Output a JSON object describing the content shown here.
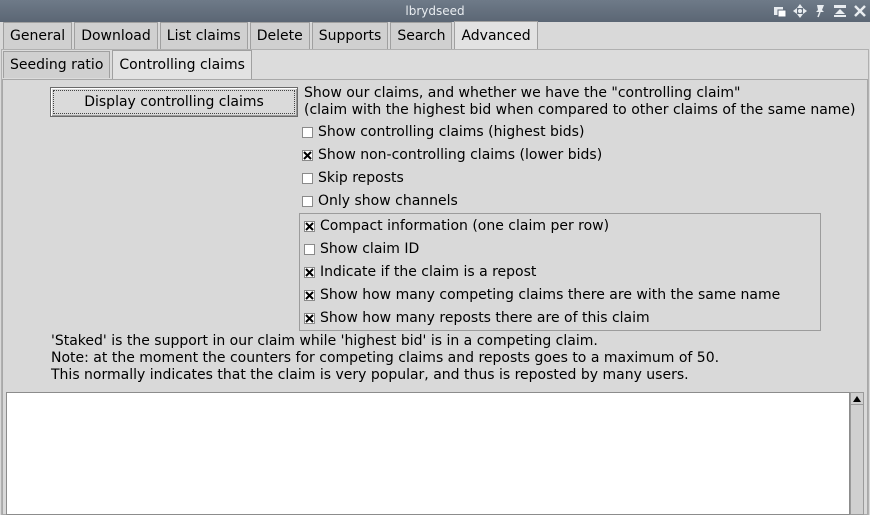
{
  "window": {
    "title": "lbrydseed"
  },
  "tabs": [
    {
      "label": "General"
    },
    {
      "label": "Download"
    },
    {
      "label": "List claims"
    },
    {
      "label": "Delete"
    },
    {
      "label": "Supports"
    },
    {
      "label": "Search"
    },
    {
      "label": "Advanced"
    }
  ],
  "subtabs": [
    {
      "label": "Seeding ratio"
    },
    {
      "label": "Controlling claims"
    }
  ],
  "display_button": "Display controlling claims",
  "description": [
    "Show our claims, and whether we have the \"controlling claim\"",
    "(claim with the highest bid when compared to other claims of the same name)"
  ],
  "options": [
    {
      "label": "Show controlling claims (highest bids)",
      "checked": false
    },
    {
      "label": "Show non-controlling claims (lower bids)",
      "checked": true
    },
    {
      "label": "Skip reposts",
      "checked": false
    },
    {
      "label": "Only show channels",
      "checked": false
    }
  ],
  "display_options": [
    {
      "label": "Compact information (one claim per row)",
      "checked": true
    },
    {
      "label": "Show claim ID",
      "checked": false
    },
    {
      "label": "Indicate if the claim is a repost",
      "checked": true
    },
    {
      "label": "Show how many competing claims there are with the same name",
      "checked": true
    },
    {
      "label": "Show how many reposts there are of this claim",
      "checked": true
    }
  ],
  "notes": [
    "'Staked' is the support in our claim while 'highest bid' is in a competing claim.",
    "Note: at the moment the counters for competing claims and reposts goes to a maximum of 50.",
    "This normally indicates that the claim is very popular, and thus is reposted by many users."
  ],
  "icons": {
    "window_controls": [
      "restore-icon",
      "move-icon",
      "pin-icon",
      "shade-icon",
      "close-icon"
    ]
  }
}
